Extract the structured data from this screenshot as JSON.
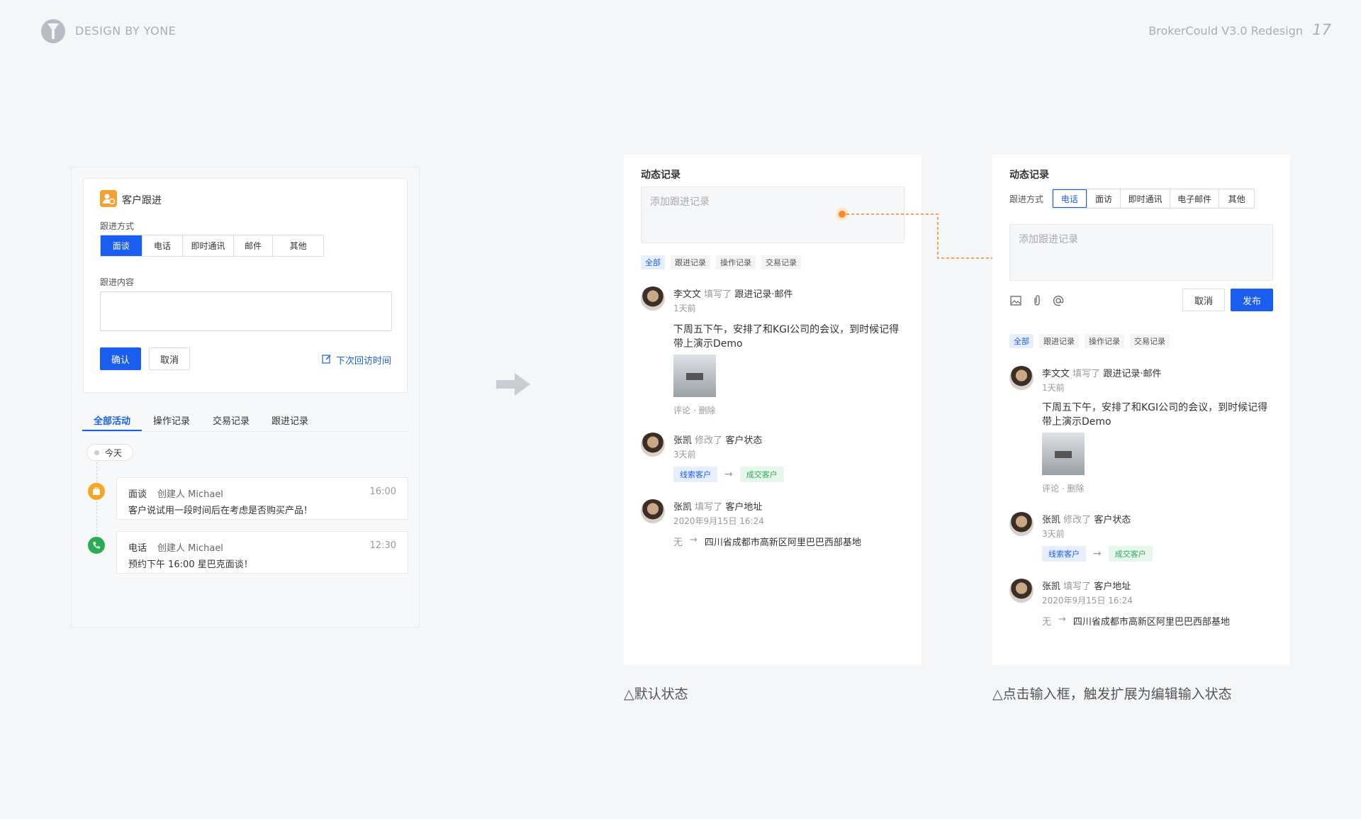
{
  "header": {
    "brand": "DESIGN BY YONE",
    "project": "BrokerCould V3.0 Redesign",
    "page_number": "17"
  },
  "left": {
    "card_title": "客户跟进",
    "method_label": "跟进方式",
    "methods": [
      "面谈",
      "电话",
      "即时通讯",
      "邮件",
      "其他"
    ],
    "content_label": "跟进内容",
    "confirm": "确认",
    "cancel": "取消",
    "next_visit": "下次回访时间",
    "tabs": [
      "全部活动",
      "操作记录",
      "交易记录",
      "跟进记录"
    ],
    "today": "今天",
    "items": [
      {
        "type": "面谈",
        "creator": "创建人 Michael",
        "time": "16:00",
        "text": "客户说试用一段时间后在考虑是否购买产品！"
      },
      {
        "type": "电话",
        "creator": "创建人 Michael",
        "time": "12:30",
        "text": "预约下午 16:00 星巴克面谈！"
      }
    ]
  },
  "middle": {
    "title": "动态记录",
    "placeholder": "添加跟进记录",
    "tabs": [
      "全部",
      "跟进记录",
      "操作记录",
      "交易记录"
    ],
    "feed": [
      {
        "name": "李文文",
        "action": "填写了",
        "object": "跟进记录·邮件",
        "time": "1天前",
        "body1": "下周五下午，安排了和KGI公司的会议，到时候记得",
        "body2": "带上演示Demo",
        "comment": "评论 · 删除"
      },
      {
        "name": "张凯",
        "action": "修改了",
        "object": "客户状态",
        "time": "3天前",
        "from": "线索客户",
        "to": "成交客户"
      },
      {
        "name": "张凯",
        "action": "填写了",
        "object": "客户地址",
        "time": "2020年9月15日 16:24",
        "from": "无",
        "to": "四川省成都市高新区阿里巴巴西部基地"
      }
    ],
    "caption": "△默认状态"
  },
  "right": {
    "title": "动态记录",
    "method_label": "跟进方式",
    "methods": [
      "电话",
      "面访",
      "即时通讯",
      "电子邮件",
      "其他"
    ],
    "placeholder": "添加跟进记录",
    "cancel": "取消",
    "publish": "发布",
    "tabs": [
      "全部",
      "跟进记录",
      "操作记录",
      "交易记录"
    ],
    "feed": [
      {
        "name": "李文文",
        "action": "填写了",
        "object": "跟进记录·邮件",
        "time": "1天前",
        "body1": "下周五下午，安排了和KGI公司的会议，到时候记得",
        "body2": "带上演示Demo",
        "comment": "评论 · 删除"
      },
      {
        "name": "张凯",
        "action": "修改了",
        "object": "客户状态",
        "time": "3天前",
        "from": "线索客户",
        "to": "成交客户"
      },
      {
        "name": "张凯",
        "action": "填写了",
        "object": "客户地址",
        "time": "2020年9月15日 16:24",
        "from": "无",
        "to": "四川省成都市高新区阿里巴巴西部基地"
      }
    ],
    "caption": "△点击输入框，触发扩展为编辑输入状态"
  },
  "colors": {
    "accent": "#1a5ef0",
    "connector": "#f58a1f",
    "success": "#2eaa55"
  }
}
